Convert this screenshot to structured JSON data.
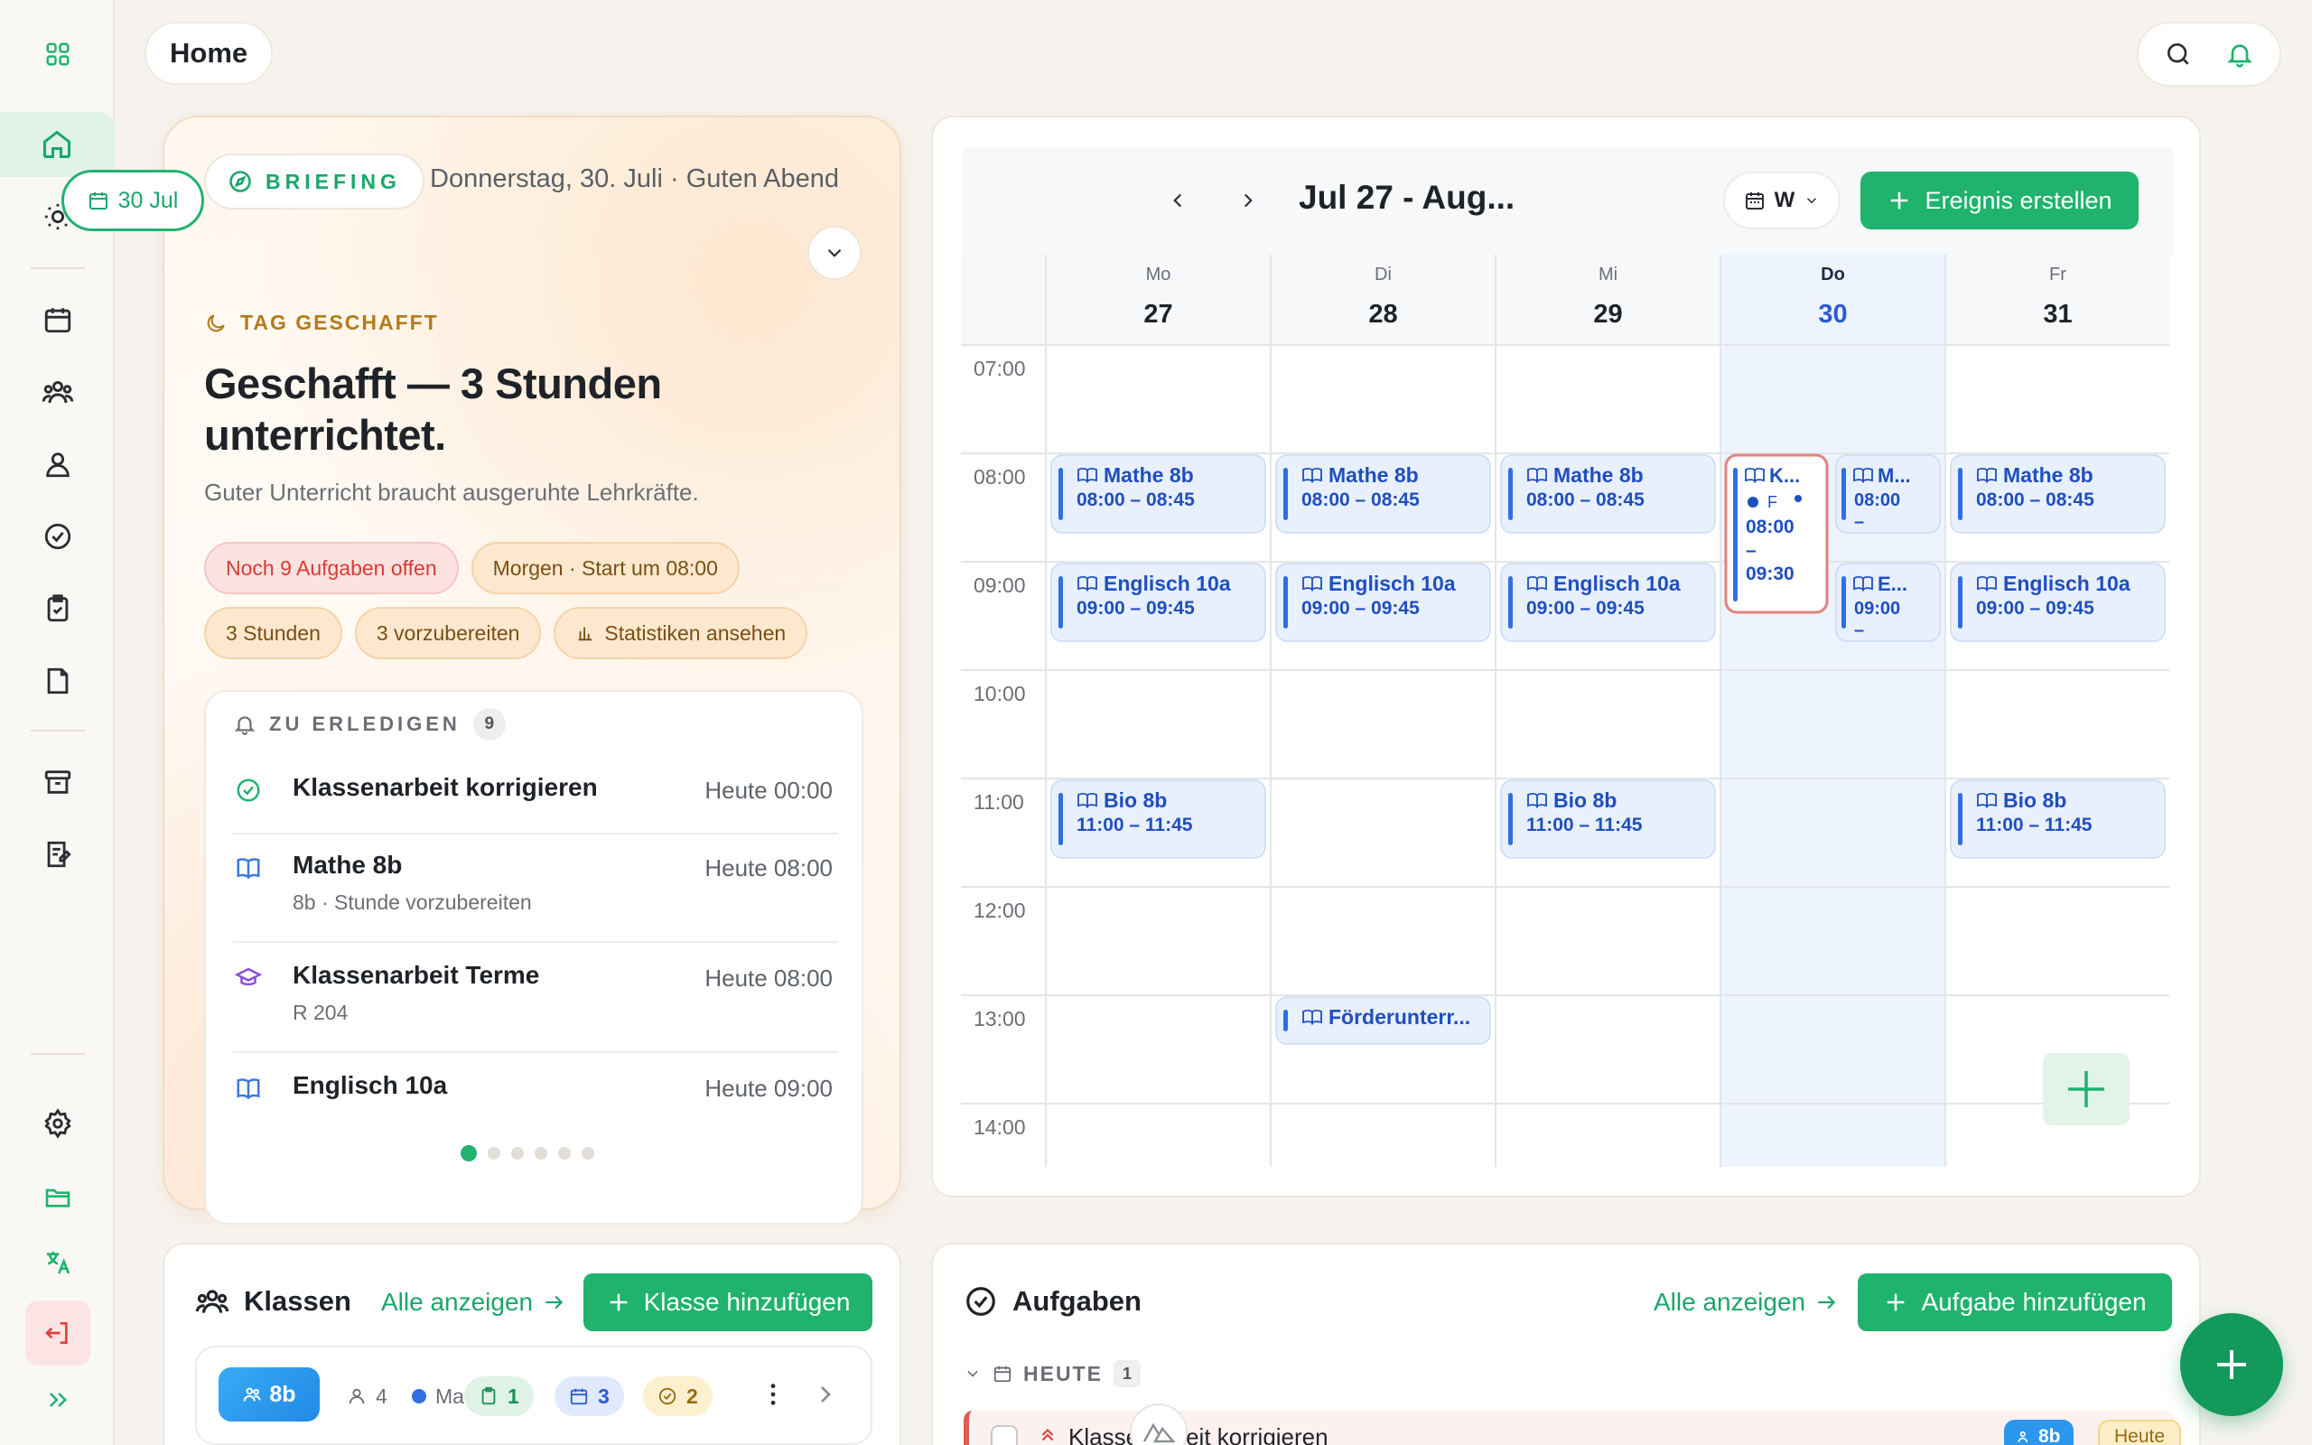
{
  "header": {
    "title": "Home"
  },
  "briefing": {
    "tag": "BRIEFING",
    "date_greeting": "Donnerstag, 30. Juli · Guten Abend",
    "day_label": "TAG GESCHAFFT",
    "title": "Geschafft — 3 Stunden unterrichtet.",
    "subtitle": "Guter Unterricht braucht ausgeruhte Lehrkräfte.",
    "chips_row1": [
      "Noch 9 Aufgaben offen",
      "Morgen · Start um 08:00"
    ],
    "chips_row2": [
      "3 Stunden",
      "3 vorzubereiten",
      "Statistiken ansehen"
    ],
    "todo": {
      "heading": "ZU ERLEDIGEN",
      "count": "9",
      "items": [
        {
          "title": "Klassenarbeit korrigieren",
          "sub": "",
          "time": "Heute 00:00"
        },
        {
          "title": "Mathe 8b",
          "sub": "8b · Stunde vorzubereiten",
          "time": "Heute 08:00"
        },
        {
          "title": "Klassenarbeit Terme",
          "sub": "R 204",
          "time": "Heute 08:00"
        },
        {
          "title": "Englisch 10a",
          "sub": "",
          "time": "Heute 09:00"
        }
      ]
    },
    "pager": {
      "count": 6,
      "active": 0
    }
  },
  "calendar": {
    "today_label": "30 Jul",
    "range": "Jul 27 - Aug...",
    "view": "W",
    "create_label": "Ereignis erstellen",
    "days": [
      {
        "dow": "Mo",
        "num": "27"
      },
      {
        "dow": "Di",
        "num": "28"
      },
      {
        "dow": "Mi",
        "num": "29"
      },
      {
        "dow": "Do",
        "num": "30"
      },
      {
        "dow": "Fr",
        "num": "31"
      }
    ],
    "today_index": 3,
    "hours": [
      "07:00",
      "08:00",
      "09:00",
      "10:00",
      "11:00",
      "12:00",
      "13:00",
      "14:00"
    ],
    "events": [
      {
        "day": 0,
        "title": "Mathe 8b",
        "time": "08:00 – 08:45"
      },
      {
        "day": 1,
        "title": "Mathe 8b",
        "time": "08:00 – 08:45"
      },
      {
        "day": 2,
        "title": "Mathe 8b",
        "time": "08:00 – 08:45"
      },
      {
        "day": 4,
        "title": "Mathe 8b",
        "time": "08:00 – 08:45"
      },
      {
        "day": 0,
        "title": "Englisch 10a",
        "time": "09:00 – 09:45"
      },
      {
        "day": 1,
        "title": "Englisch 10a",
        "time": "09:00 – 09:45"
      },
      {
        "day": 2,
        "title": "Englisch 10a",
        "time": "09:00 – 09:45"
      },
      {
        "day": 4,
        "title": "Englisch 10a",
        "time": "09:00 – 09:45"
      },
      {
        "day": 0,
        "title": "Bio 8b",
        "time": "11:00 – 11:45"
      },
      {
        "day": 2,
        "title": "Bio 8b",
        "time": "11:00 – 11:45"
      },
      {
        "day": 4,
        "title": "Bio 8b",
        "time": "11:00 – 11:45"
      },
      {
        "day": 1,
        "title": "Förderunterr...",
        "time": ""
      }
    ],
    "today_events": {
      "exam": {
        "title": "K...",
        "loc": "F",
        "start": "08:00",
        "dash": "–",
        "end": "09:30"
      },
      "math": {
        "title": "M...",
        "start": "08:00",
        "dash": "–"
      },
      "english": {
        "title": "E...",
        "start": "09:00",
        "dash": "–"
      }
    }
  },
  "classes": {
    "title": "Klassen",
    "all_label": "Alle anzeigen",
    "add_label": "Klasse hinzufügen",
    "row": {
      "badge": "8b",
      "students": "4",
      "subject": "Mat",
      "docs": "1",
      "events": "3",
      "tasks": "2"
    }
  },
  "tasks": {
    "title": "Aufgaben",
    "all_label": "Alle anzeigen",
    "add_label": "Aufgabe hinzufügen",
    "section": "HEUTE",
    "section_count": "1",
    "item": {
      "title": "Klassenarbeit korrigieren",
      "badge": "8b",
      "due": "Heute"
    }
  },
  "colors": {
    "accent": "#1fb36d",
    "event_bg": "#e8f0fd",
    "event_text": "#1f4fbf",
    "today_col": "#eef4fd",
    "exam_border": "#e0837e"
  }
}
